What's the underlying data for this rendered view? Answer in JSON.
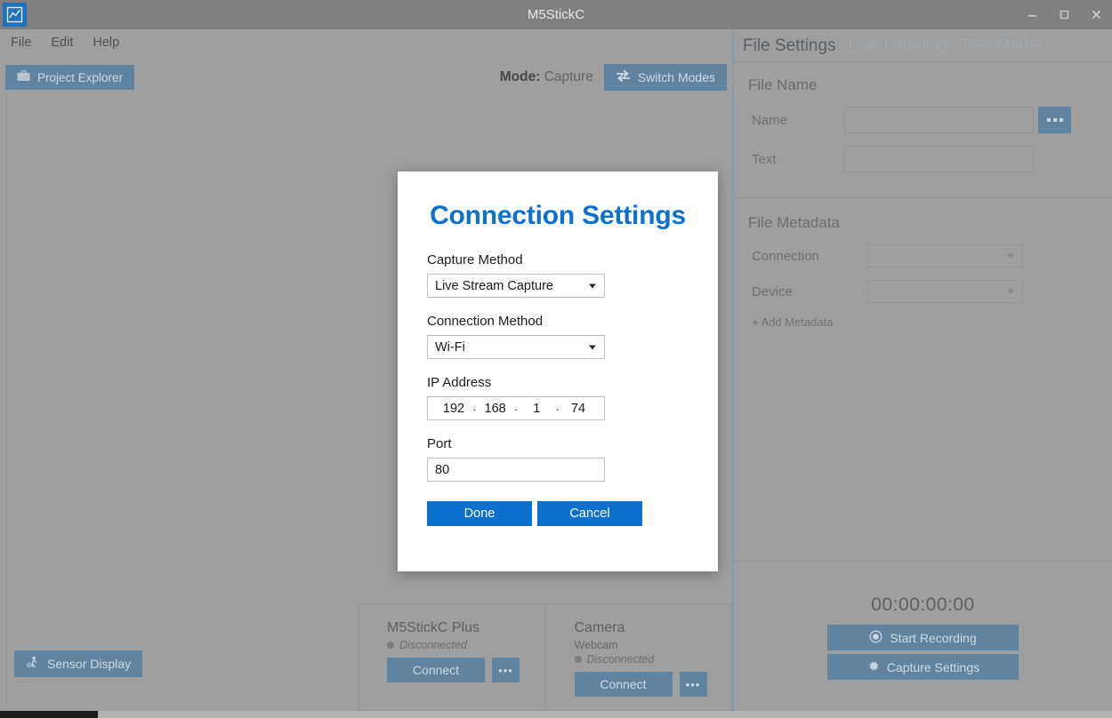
{
  "window": {
    "title": "M5StickC",
    "app_icon": "line-chart-icon",
    "minimize": "–",
    "maximize": "☐",
    "close": "✕"
  },
  "menubar": {
    "items": [
      {
        "label": "File"
      },
      {
        "label": "Edit"
      },
      {
        "label": "Help"
      }
    ]
  },
  "toolbar": {
    "project_explorer": "Project Explorer",
    "project_explorer_icon": "briefcase-icon",
    "mode_prefix": "Mode:",
    "mode_value": "Capture",
    "switch_modes": "Switch Modes",
    "switch_modes_icon": "swap-arrows-icon"
  },
  "canvas": {
    "sensor_display": "Sensor Display",
    "sensor_display_icon": "sensor-walk-icon"
  },
  "devices": [
    {
      "name": "M5StickC Plus",
      "subtitle": "",
      "status": "Disconnected",
      "status_color": "#7e7e7e",
      "connect": "Connect",
      "more": "•••"
    },
    {
      "name": "Camera",
      "subtitle": "Webcam",
      "status": "Disconnected",
      "status_color": "#7e7e7e",
      "connect": "Connect",
      "more": "•••"
    }
  ],
  "right_panel": {
    "tabs": [
      {
        "label": "File Settings",
        "active": true
      },
      {
        "label": "Live Labeling",
        "active": false
      },
      {
        "label": "Test Model",
        "active": false
      }
    ],
    "file_name": {
      "section_title": "File Name",
      "name_label": "Name",
      "name_value": "",
      "name_browse": "browse-ellipsis-button",
      "text_label": "Text",
      "text_value": ""
    },
    "file_metadata": {
      "section_title": "File Metadata",
      "connection_label": "Connection",
      "connection_value": "",
      "device_label": "Device",
      "device_value": "",
      "add_metadata": "+ Add Metadata"
    },
    "recording": {
      "timer": "00:00:00:00",
      "start_recording": "Start Recording",
      "start_recording_icon": "record-circle-icon",
      "capture_settings": "Capture Settings",
      "capture_settings_icon": "gear-icon"
    }
  },
  "dialog": {
    "title": "Connection Settings",
    "capture_method_label": "Capture Method",
    "capture_method_value": "Live Stream Capture",
    "connection_method_label": "Connection Method",
    "connection_method_value": "Wi-Fi",
    "ip_label": "IP Address",
    "ip_octets": [
      "192",
      "168",
      "1",
      "74"
    ],
    "ip_separator": "·",
    "port_label": "Port",
    "port_value": "80",
    "done": "Done",
    "cancel": "Cancel"
  },
  "colors": {
    "accent_blue": "#0a72ce",
    "steel_blue": "#5b87a8",
    "titlebar_gray": "#828282",
    "body_gray": "#a8a8a8"
  }
}
